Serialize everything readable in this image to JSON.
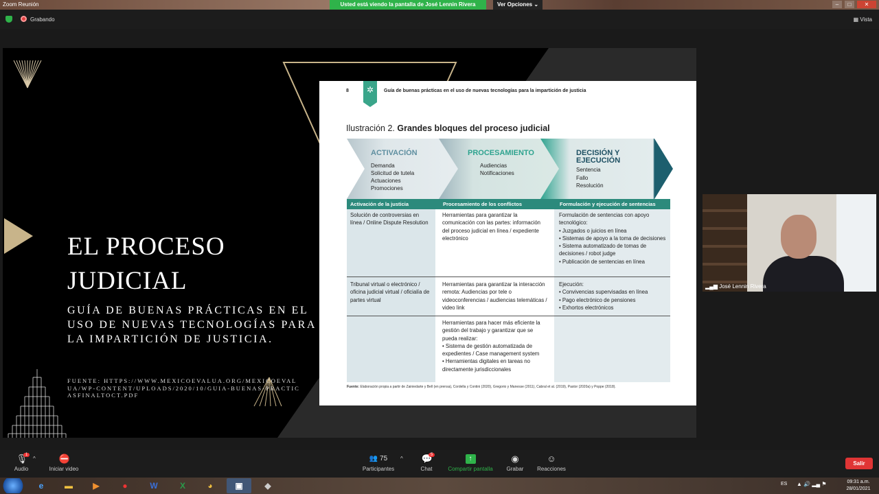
{
  "titlebar": {
    "app_name": "Zoom Reunión",
    "share_banner": "Usted está viendo la pantalla de José Lennin Rivera",
    "view_options": "Ver Opciones",
    "minimize": "–",
    "maximize": "□",
    "close": "✕"
  },
  "status": {
    "recording": "Grabando",
    "view": "Vista"
  },
  "slide": {
    "title": "EL PROCESO JUDICIAL",
    "subtitle": "GUÍA DE BUENAS PRÁCTICAS EN EL USO DE NUEVAS TECNOLOGÍAS PARA LA IMPARTICIÓN DE JUSTICIA.",
    "source": "FUENTE: HTTPS://WWW.MEXICOEVALUA.ORG/MEXICOEVALUA/WP-CONTENT/UPLOADS/2020/10/GUIA-BUENAS-PRACTICASFINALTOCT.PDF"
  },
  "doc": {
    "page_number": "8",
    "header": "Guía de buenas prácticas en el uso de nuevas tecnologías para la impartición de justicia",
    "illustration_prefix": "Ilustración 2.",
    "illustration_title": "Grandes bloques del proceso judicial",
    "stages": [
      {
        "title": "ACTIVACIÓN",
        "items": [
          "Demanda",
          "Solicitud de tutela",
          "Actuaciones",
          "Promociones"
        ]
      },
      {
        "title": "PROCESAMIENTO",
        "items": [
          "Audiencias",
          "Notificaciones"
        ]
      },
      {
        "title": "DECISIÓN Y EJECUCIÓN",
        "items": [
          "Sentencia",
          "Fallo",
          "Resolución"
        ]
      }
    ],
    "columns": [
      "Activación de la justicia",
      "Procesamiento de los conflictos",
      "Formulación y ejecución de sentencias"
    ],
    "rows": [
      [
        "Solución de controversias en línea / Online Dispute Resolution",
        "Herramientas para garantizar la comunicación con las partes: información del proceso judicial en línea / expediente electrónico",
        "Formulación de sentencias con apoyo tecnológico:\n• Juzgados o juicios en línea\n• Sistemas de apoyo a la toma de decisiones\n• Sistema automatizado de tomas de decisiones / robot judge\n• Publicación de sentencias en línea"
      ],
      [
        "Tribunal virtual o electrónico / oficina judicial virtual / oficialía de partes virtual",
        "Herramientas para garantizar la interacción remota: Audiencias por tele o videoconferencias / audiencias telemáticas / video link",
        "Ejecución:\n• Convivencias supervisadas en línea\n• Pago electrónico de pensiones\n• Exhortos electrónicos"
      ],
      [
        "",
        "Herramientas para hacer más eficiente la gestión del trabajo y garantizar que se pueda realizar:\n• Sistema de gestión automatizada de expedientes / Case management system\n• Herramientas digitales en tareas no directamente jurisdiccionales",
        ""
      ]
    ],
    "footnote_label": "Fuente:",
    "footnote": "Elaboración propia a partir de Zainiedarte y Bell (en prensa), Cordella y Contini (2020), Gregorio y Manesse (2011), Cabral et al. (2019), Pastor (2020a) y Poppe (2018)."
  },
  "video": {
    "participant_name": "José Lennin Rivera"
  },
  "toolbar": {
    "audio": "Audio",
    "video": "Iniciar video",
    "participants": "Participantes",
    "participants_count": "75",
    "chat": "Chat",
    "chat_badge": "5",
    "share": "Compartir pantalla",
    "record": "Grabar",
    "reactions": "Reacciones",
    "leave": "Salir",
    "audio_badge": "1"
  },
  "taskbar": {
    "lang": "ES",
    "time": "09:31 a.m.",
    "date": "28/01/2021"
  },
  "colors": {
    "accent_green": "#2fb34a",
    "teal": "#2c8a7c",
    "leave_red": "#e03535",
    "gold": "#c8b48a"
  }
}
